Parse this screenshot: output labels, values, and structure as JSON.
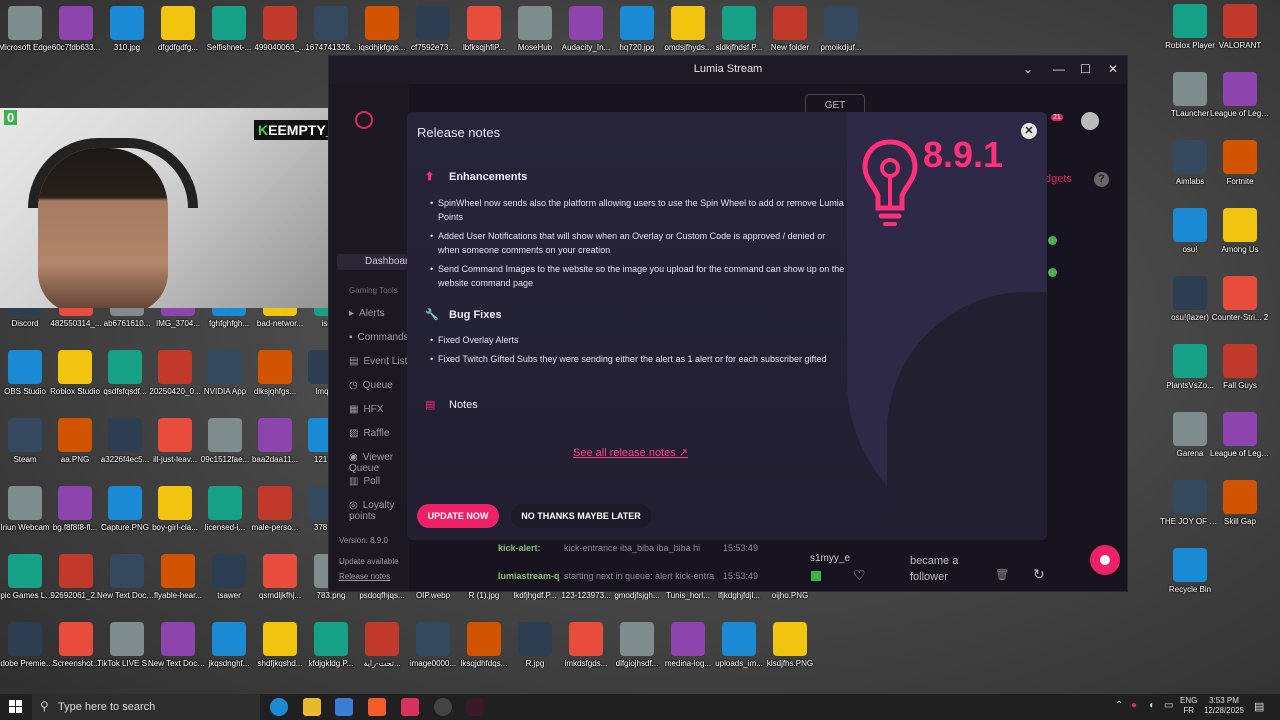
{
  "desktop": {
    "top_row": [
      "Microsoft Edge",
      "60c7fdb633...",
      "310.jpg",
      "dfgdfgdfg...",
      "Selfishnet-...",
      "499040063_...",
      "1674741328...",
      "iqsdhjkfgqs...",
      "cf7592e73...",
      "lbfksqjhfiP...",
      "MoseHub",
      "Audacity_In...",
      "hq720.jpg",
      "omdsjfhyds...",
      "sldkjfhdsf.P...",
      "New folder",
      "pmoikdjuf..."
    ],
    "left_col": [
      "Discord",
      "482550314_...",
      "ab6761610...",
      "IMG_3704...",
      "fghfghfgh...",
      "bad-networ...",
      "isqdjf"
    ],
    "row3": [
      "OBS Studio",
      "Roblox Studio",
      "qsdfsfqsdf...",
      "20250420_0...",
      "NVIDIA App",
      "dlksjqhfgs...",
      "lmqsj"
    ],
    "row4": [
      "Steam",
      "aa.PNG",
      "a3226f4ec5...",
      "ill-just-leav...",
      "09c1512fae...",
      "baa2daa11...",
      "12172"
    ],
    "row5": [
      "Iriun Webcam",
      "bg.f8f8f8-fl...",
      "Capture.PNG",
      "boy-girl-cla...",
      "licensed-i...",
      "male-perso...",
      "37816"
    ],
    "row6": [
      "Epic Games Launcher",
      "92692061_2...",
      "New Text Docume...",
      "flyable-hear...",
      "tsawer",
      "qsmdljkfhj...",
      "783.png",
      "psdoqfhjqs...",
      "OIP.webp",
      "R (1).jpg",
      "lkdfjhgdf.P...",
      "123-123973...",
      "gmodjfsjgh...",
      "Tunis_horl...",
      "lfjkdghjfdjl...",
      "oijho.PNG"
    ],
    "row7": [
      "Adobe Premiere Pro",
      "Screenshot...",
      "TikTok LIVE Studio",
      "New Text Docume...",
      "jkqsdnghf...",
      "shdfjkqshd...",
      "kfdjgkldg.P...",
      "تحت-راية...",
      "image0000...",
      "lksqjdhfdqs...",
      "R.jpg",
      "lmkdsfgds...",
      "dlfgiojhsdf...",
      "medina-log...",
      "uploads_im...",
      "klsdjfhs.PNG"
    ],
    "right_col": [
      "Roblox Player",
      "VALORANT",
      "TLauncher",
      "League of Legends",
      "Aimlabs",
      "Fortnite",
      "osu!",
      "Among Us",
      "osu!(lazer)",
      "Counter-Stri... 2",
      "PlantsVsZo...",
      "Fall Guys",
      "Garena",
      "League of Legends PBE",
      "THE JOY OF CREATIO...",
      "Skill Gap",
      "Recycle Bin"
    ]
  },
  "webcam": {
    "counter": "0",
    "tag_k": "K",
    "tag_text": "EEMPTY_4k"
  },
  "app": {
    "title": "Lumia Stream",
    "get_label": "GET",
    "notif_count": "21",
    "widgets_label": "dgets",
    "sidebar": [
      "Dashboard",
      "Gaming Tools",
      "Alerts",
      "Commands",
      "Event List",
      "Queue",
      "HFX",
      "Raffle",
      "Viewer Queue",
      "Poll",
      "Loyalty points"
    ],
    "version": "Version: 8.9.0",
    "update_available": "Update available",
    "release_notes_link": "Release notes",
    "events": [
      {
        "user": "kick-alert:",
        "msg": "kick-entrance iba_biba iba_biba hi",
        "time": "15:53:49"
      },
      {
        "user": "lumiastream-q",
        "msg": "starting next in queue: alert kick-entra",
        "time": "15:53:49"
      }
    ],
    "follower": {
      "name": "s1myy_e",
      "text": "became a follower"
    }
  },
  "modal": {
    "title": "Release notes",
    "version": "8.9.1",
    "sections": [
      {
        "heading": "Enhancements",
        "icon": "arrow-up-icon",
        "items": [
          "SpinWheel now sends also the platform allowing users to use the Spin Wheel to add or remove Lumia Points",
          "Added User Notifications that will show when an Overlay or Custom Code is approved / denied or when someone comments on your creation",
          "Send Command Images to the website so the image you upload for the command can show up on the website command page"
        ]
      },
      {
        "heading": "Bug Fixes",
        "icon": "wrench-icon",
        "items": [
          "Fixed Overlay Alerts",
          "Fixed Twitch Gifted Subs they were sending either the alert as 1 alert or for each subscriber gifted"
        ]
      },
      {
        "heading": "Notes",
        "icon": "notes-icon",
        "items": []
      }
    ],
    "see_all": "See all release notes",
    "update_now": "UPDATE NOW",
    "no_thanks": "NO THANKS MAYBE LATER"
  },
  "taskbar": {
    "search_placeholder": "Type here to search",
    "lang": "ENG",
    "region": "FR",
    "time": "3:53 PM",
    "date": "12/28/2025"
  },
  "colors": {
    "accent": "#ee2168",
    "modal_bg": "#27243a",
    "app_bg": "#17141f",
    "taskbar": "#202020"
  }
}
